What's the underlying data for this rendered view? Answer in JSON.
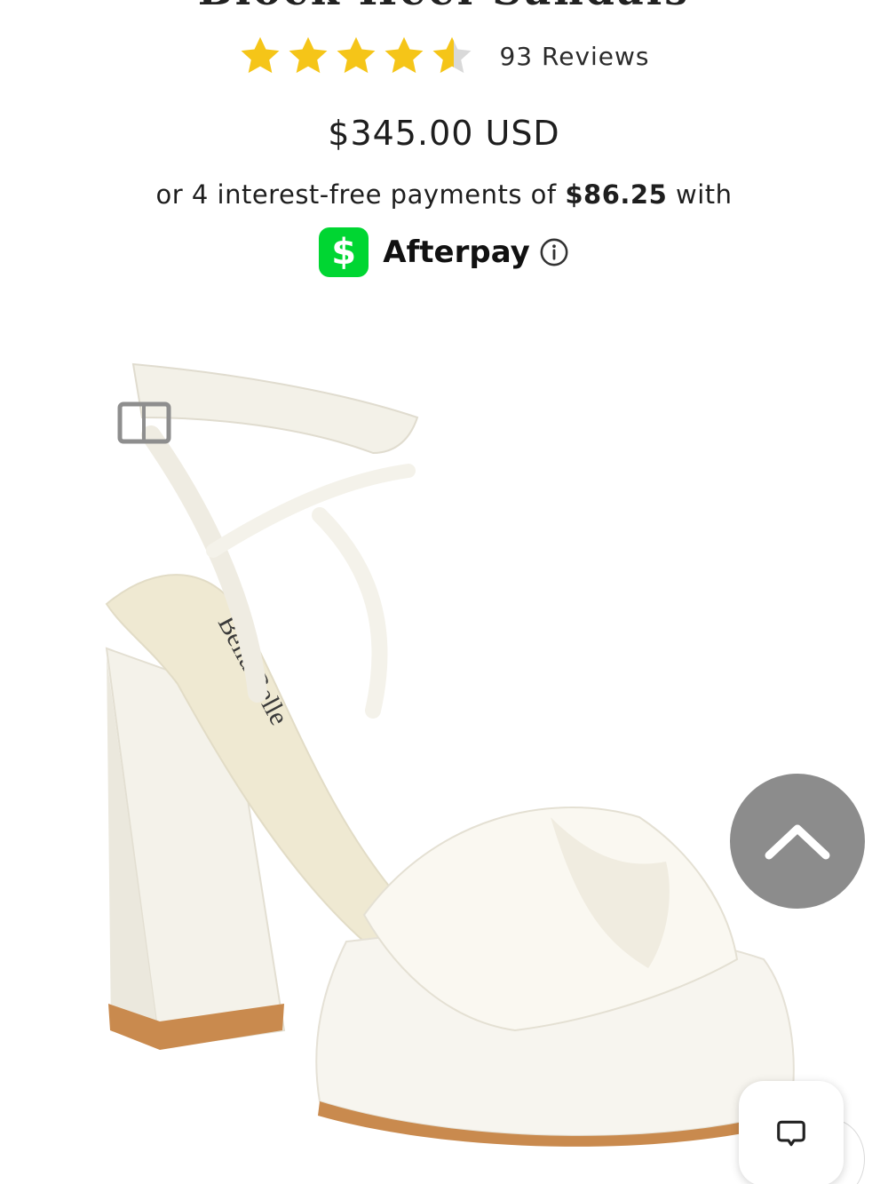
{
  "product": {
    "title": "Block Heel Sandals",
    "rating": 4.5,
    "reviews_label": "93 Reviews",
    "price": "$345.00 USD",
    "installment_prefix": "or 4 interest-free payments of ",
    "installment_amount": "$86.25",
    "installment_suffix": " with",
    "afterpay_label": "Afterpay",
    "image_brand_text": "Bella Belle",
    "image_alt": "White satin platform block heel sandal with knotted toe strap and ankle wrap"
  },
  "colors": {
    "star": "#f5c518",
    "afterpay_badge": "#00d632",
    "scroll_button": "#8c8c8c"
  },
  "icons": {
    "rating": "star-icon",
    "payment": "cashapp-dollar-icon",
    "info": "info-circle-icon",
    "scroll": "chevron-up-icon",
    "chat": "chat-bubble-icon"
  }
}
